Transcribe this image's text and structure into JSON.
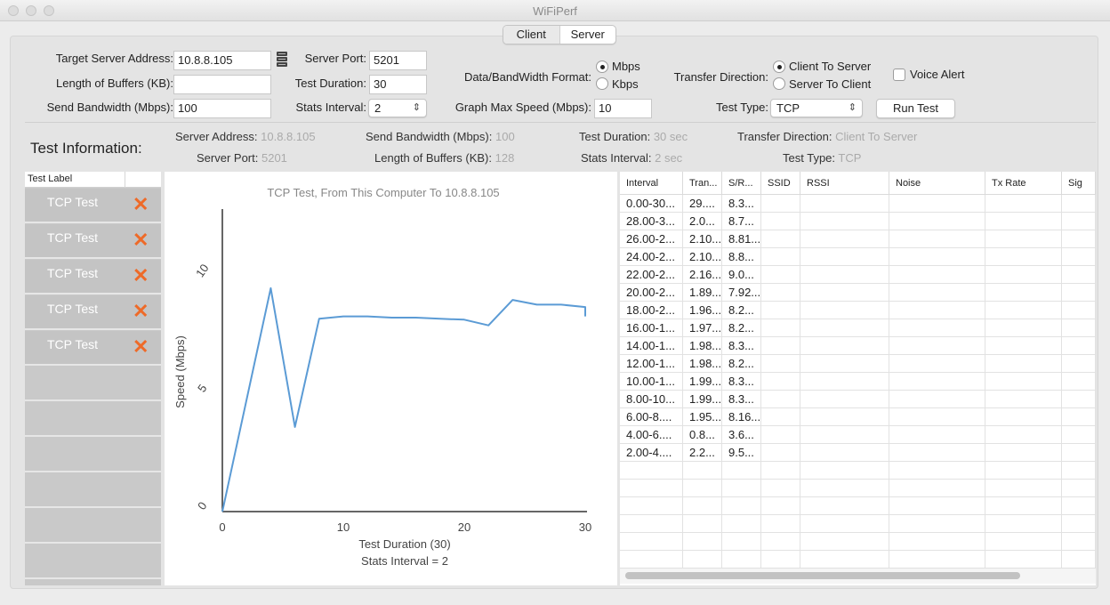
{
  "window": {
    "title": "WiFiPerf"
  },
  "mode_tabs": [
    "Client",
    "Server"
  ],
  "form": {
    "target_server_label": "Target Server Address:",
    "target_server_value": "10.8.8.105",
    "buffers_label": "Length of Buffers (KB):",
    "buffers_value": "",
    "send_bw_label": "Send Bandwidth (Mbps):",
    "send_bw_value": "100",
    "server_port_label": "Server Port:",
    "server_port_value": "5201",
    "test_duration_label": "Test Duration:",
    "test_duration_value": "30",
    "stats_interval_label": "Stats Interval:",
    "stats_interval_value": "2",
    "format_label": "Data/BandWidth Format:",
    "format_options": [
      "Mbps",
      "Kbps"
    ],
    "graph_max_label": "Graph Max Speed (Mbps):",
    "graph_max_value": "10",
    "direction_label": "Transfer Direction:",
    "direction_options": [
      "Client To Server",
      "Server To Client"
    ],
    "voice_alert_label": "Voice Alert",
    "test_type_label": "Test Type:",
    "test_type_value": "TCP",
    "run_button": "Run Test"
  },
  "info": {
    "heading": "Test Information:",
    "server_address_label": "Server Address:",
    "server_address_value": "10.8.8.105",
    "server_port_label": "Server Port:",
    "server_port_value": "5201",
    "send_bw_label": "Send Bandwidth (Mbps):",
    "send_bw_value": "100",
    "buffers_label": "Length of Buffers (KB):",
    "buffers_value": "128",
    "duration_label": "Test Duration:",
    "duration_value": "30 sec",
    "interval_label": "Stats Interval:",
    "interval_value": "2 sec",
    "direction_label": "Transfer Direction:",
    "direction_value": "Client To Server",
    "type_label": "Test Type:",
    "type_value": "TCP"
  },
  "test_list": {
    "header": "Test Label",
    "items": [
      "TCP Test",
      "TCP Test",
      "TCP Test",
      "TCP Test",
      "TCP Test"
    ]
  },
  "chart_data": {
    "type": "line",
    "title": "TCP Test,  From This Computer To 10.8.8.105",
    "xlabel": "Test Duration (30)",
    "xlabel2": "Stats Interval = 2",
    "ylabel": "Speed (Mbps)",
    "xlim": [
      0,
      30
    ],
    "ylim": [
      0,
      14
    ],
    "xticks": [
      "0",
      "10",
      "20",
      "30"
    ],
    "yticks": [
      "0",
      "5",
      "10"
    ],
    "color": "#5b9bd5",
    "x": [
      0,
      4,
      6,
      8,
      10,
      12,
      14,
      16,
      18,
      20,
      22,
      24,
      26,
      28,
      30,
      30
    ],
    "y": [
      0,
      9.5,
      3.6,
      8.2,
      8.3,
      8.3,
      8.25,
      8.25,
      8.2,
      8.16,
      7.92,
      9.0,
      8.8,
      8.8,
      8.7,
      8.3
    ]
  },
  "table": {
    "columns": [
      "Interval",
      "Tran...",
      "S/R...",
      "SSID",
      "RSSI",
      "Noise",
      "Tx Rate",
      "Sig"
    ],
    "rows": [
      [
        "0.00-30...",
        "29....",
        "8.3..."
      ],
      [
        "28.00-3...",
        "2.0...",
        "8.7..."
      ],
      [
        "26.00-2...",
        "2.10...",
        "8.81..."
      ],
      [
        "24.00-2...",
        "2.10...",
        "8.8..."
      ],
      [
        "22.00-2...",
        "2.16...",
        "9.0..."
      ],
      [
        "20.00-2...",
        "1.89...",
        "7.92..."
      ],
      [
        "18.00-2...",
        "1.96...",
        "8.2..."
      ],
      [
        "16.00-1...",
        "1.97...",
        "8.2..."
      ],
      [
        "14.00-1...",
        "1.98...",
        "8.3..."
      ],
      [
        "12.00-1...",
        "1.98...",
        "8.2..."
      ],
      [
        "10.00-1...",
        "1.99...",
        "8.3..."
      ],
      [
        "8.00-10...",
        "1.99...",
        "8.3..."
      ],
      [
        "6.00-8....",
        "1.95...",
        "8.16..."
      ],
      [
        "4.00-6....",
        "0.8...",
        "3.6..."
      ],
      [
        "2.00-4....",
        "2.2...",
        "9.5..."
      ]
    ]
  }
}
